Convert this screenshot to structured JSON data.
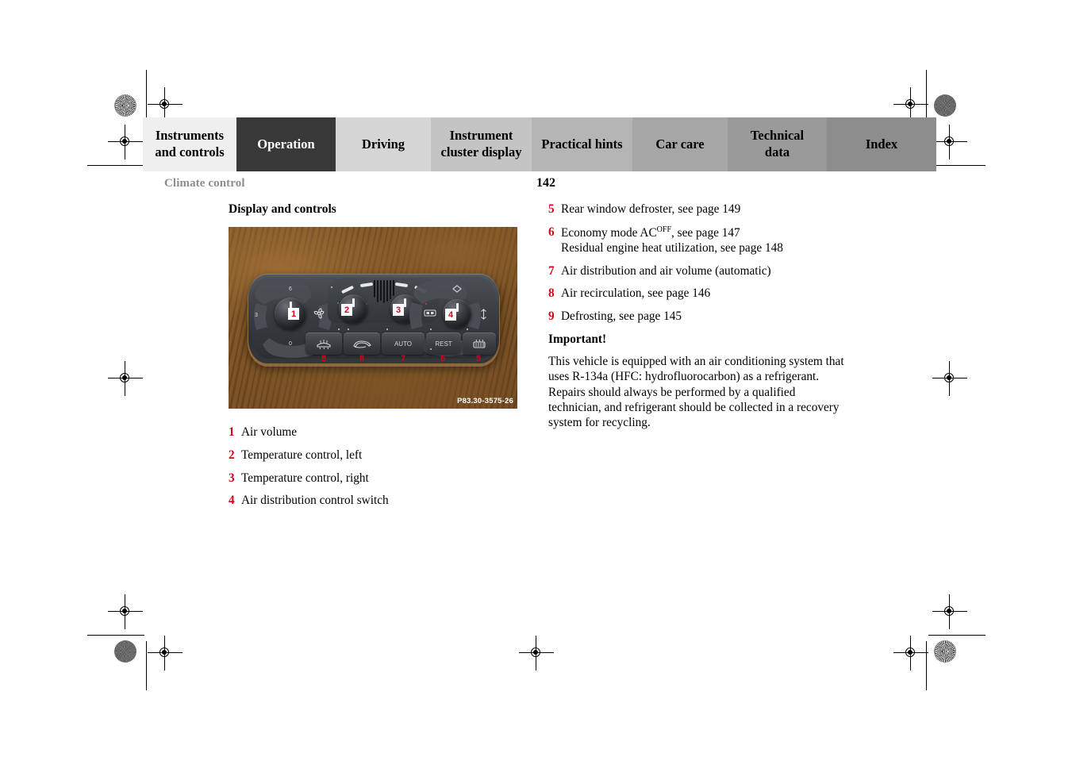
{
  "document": {
    "running_head": "Climate control",
    "page_number": "142"
  },
  "tabs": [
    {
      "label": "Instruments\nand controls",
      "color": "#efefef",
      "active": false
    },
    {
      "label": "Operation",
      "color": "#383838",
      "active": true
    },
    {
      "label": "Driving",
      "color": "#d6d6d6",
      "active": false
    },
    {
      "label": "Instrument\ncluster display",
      "color": "#c4c4c4",
      "active": false
    },
    {
      "label": "Practical hints",
      "color": "#b5b5b5",
      "active": false
    },
    {
      "label": "Car care",
      "color": "#a6a6a6",
      "active": false
    },
    {
      "label": "Technical\ndata",
      "color": "#9a9a9a",
      "active": false
    },
    {
      "label": "Index",
      "color": "#8d8d8d",
      "active": false
    }
  ],
  "left_column": {
    "section_title": "Display and controls",
    "figure": {
      "code": "P83.30-3575-26",
      "callouts": [
        "1",
        "2",
        "3",
        "4",
        "5",
        "6",
        "7",
        "8",
        "9"
      ],
      "button_labels": {
        "auto": "AUTO",
        "rest": "REST"
      },
      "dial_scale": [
        "6",
        "3",
        "0"
      ]
    },
    "items": [
      {
        "n": "1",
        "text": "Air volume"
      },
      {
        "n": "2",
        "text": "Temperature control, left"
      },
      {
        "n": "3",
        "text": "Temperature control, right"
      },
      {
        "n": "4",
        "text": "Air distribution control switch"
      }
    ]
  },
  "right_column": {
    "items": [
      {
        "n": "5",
        "text": "Rear window defroster, see page 149"
      },
      {
        "n": "6",
        "text_before": "Economy mode AC",
        "superscript": "OFF",
        "text_after": ", see page 147",
        "line2": "Residual engine heat utilization, see page 148"
      },
      {
        "n": "7",
        "text": "Air distribution and air volume (automatic)"
      },
      {
        "n": "8",
        "text": "Air recirculation, see page 146"
      },
      {
        "n": "9",
        "text": "Defrosting, see page 145"
      }
    ],
    "important": {
      "title": "Important!",
      "body": "This vehicle is equipped with an air conditioning system that uses R-134a (HFC: hydrofluorocarbon) as a refrigerant. Repairs should always be performed by a qualified technician, and refrigerant should be collected in a recovery system for recycling."
    }
  },
  "colors": {
    "callout_red": "#d4021d",
    "running_head_gray": "#8d8d8d",
    "active_tab": "#383838"
  }
}
